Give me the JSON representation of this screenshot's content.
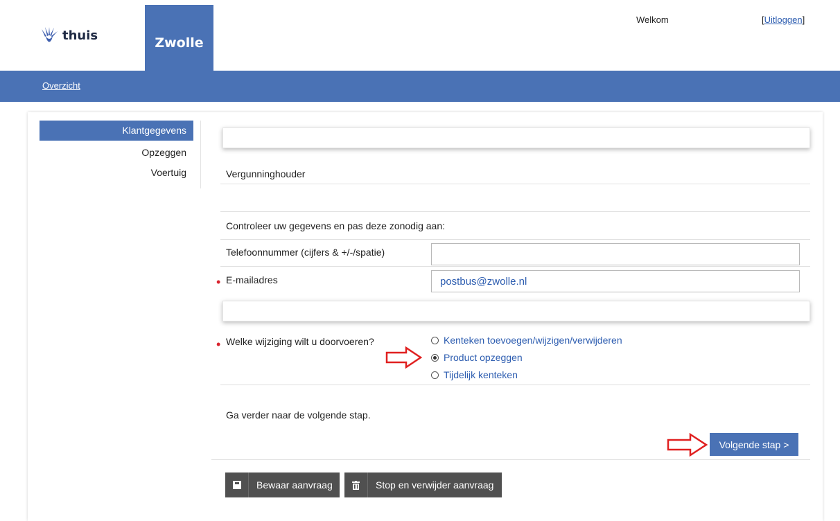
{
  "header": {
    "logo_text": "thuis",
    "city": "Zwolle",
    "welcome": "Welkom",
    "logout_label": "Uitloggen",
    "bracket_open": "[",
    "bracket_close": "]"
  },
  "nav": {
    "overview": "Overzicht"
  },
  "sidebar": {
    "items": [
      {
        "label": "Klantgegevens",
        "active": true
      },
      {
        "label": "Opzeggen",
        "active": false
      },
      {
        "label": "Voertuig",
        "active": false
      }
    ]
  },
  "form": {
    "section_title": "Vergunninghouder",
    "instruction": "Controleer uw gegevens en pas deze zonodig aan:",
    "phone_label": "Telefoonnummer (cijfers & +/-/spatie)",
    "phone_value": "",
    "email_label": "E-mailadres",
    "email_value": "postbus@zwolle.nl",
    "change_question": "Welke wijziging wilt u doorvoeren?",
    "options": [
      {
        "label": "Kenteken toevoegen/wijzigen/verwijderen",
        "selected": false
      },
      {
        "label": "Product opzeggen",
        "selected": true
      },
      {
        "label": "Tijdelijk kenteken",
        "selected": false
      }
    ],
    "next_hint": "Ga verder naar de volgende stap.",
    "next_button": "Volgende stap >"
  },
  "footer_actions": {
    "save": "Bewaar aanvraag",
    "stop": "Stop en verwijder aanvraag"
  },
  "colors": {
    "brand_blue": "#4a72b5",
    "link_blue": "#2d5db0",
    "required_red": "#d9232d",
    "annotation_red": "#e02020",
    "dark_button": "#505050"
  },
  "icons": [
    "hand-logo-icon",
    "save-icon",
    "trash-icon",
    "annotation-arrow-icon"
  ]
}
